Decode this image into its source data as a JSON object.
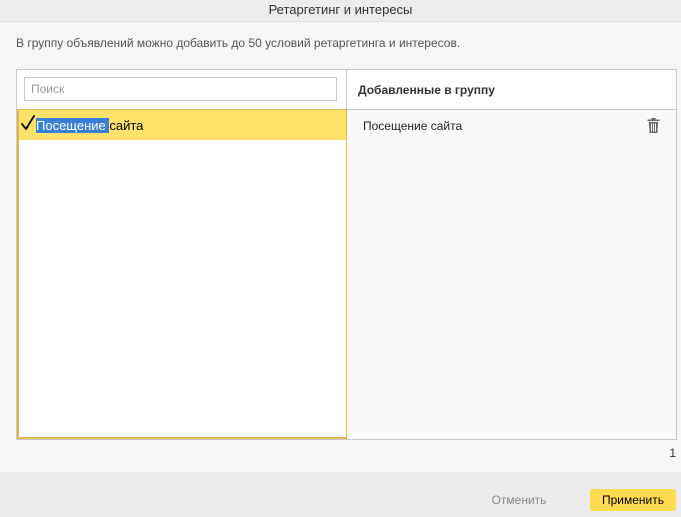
{
  "dialog": {
    "title": "Ретаргетинг и интересы",
    "intro": "В группу объявлений можно добавить до 50 условий ретаргетинга и интересов."
  },
  "left_pane": {
    "search": {
      "placeholder": "Поиск",
      "value": ""
    },
    "options": [
      {
        "label_selected": "Посещение ",
        "label_rest": "сайта",
        "checked": true,
        "icon": "checkmark-icon"
      }
    ]
  },
  "right_pane": {
    "header": "Добавленные в группу",
    "items": [
      {
        "label": "Посещение сайта",
        "icon": "trash-icon"
      }
    ]
  },
  "count": "1",
  "footer": {
    "cancel_label": "Отменить",
    "apply_label": "Применить"
  },
  "colors": {
    "accent": "#ffdb4d",
    "selected_row": "#ffe26a",
    "focus_border": "#e0b84a",
    "text_selection": "#3a7fd6"
  }
}
